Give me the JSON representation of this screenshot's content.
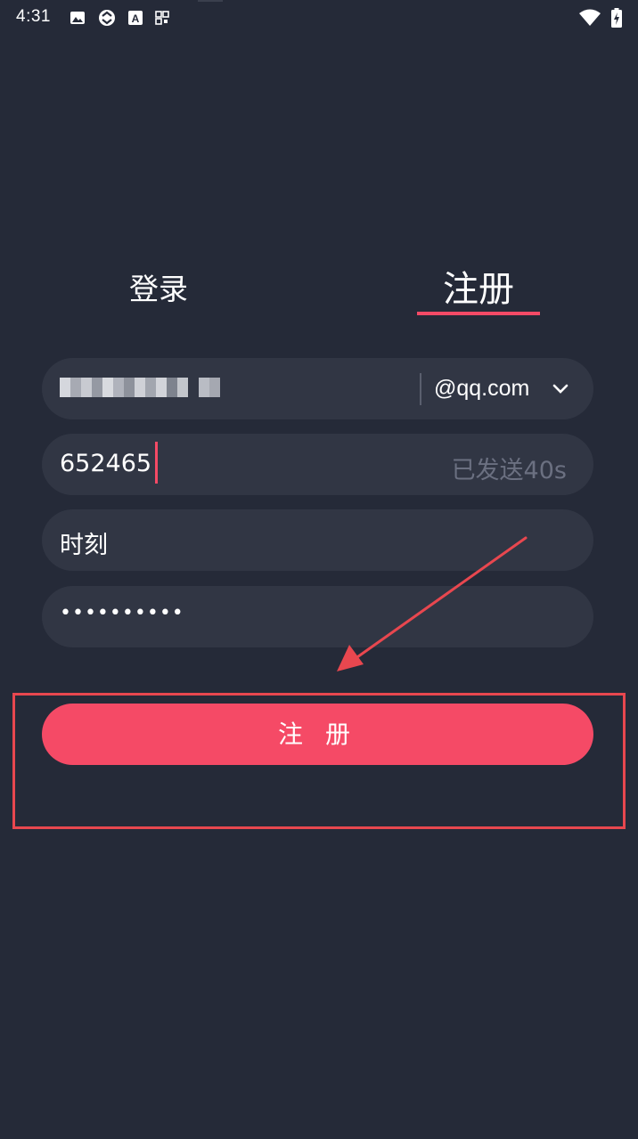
{
  "status_bar": {
    "time": "4:31",
    "left_icons": [
      "gallery-icon",
      "sync-icon",
      "font-icon",
      "qr-icon"
    ],
    "right_icons": [
      "wifi-icon",
      "battery-charging-icon"
    ]
  },
  "tabs": {
    "login_label": "登录",
    "register_label": "注册",
    "active": "register"
  },
  "form": {
    "email": {
      "value": "[pixelated]",
      "domain": "@qq.com",
      "dropdown_icon": "chevron-down-icon"
    },
    "code": {
      "value": "652465",
      "hint": "已发送40s"
    },
    "nickname": {
      "value": "时刻"
    },
    "password": {
      "value": "••••••••••"
    }
  },
  "register_button": {
    "label": "注 册"
  },
  "colors": {
    "background": "#252a38",
    "field": "#313644",
    "accent": "#f54a66",
    "hint": "#6b7081",
    "annotation": "#e8474f"
  }
}
